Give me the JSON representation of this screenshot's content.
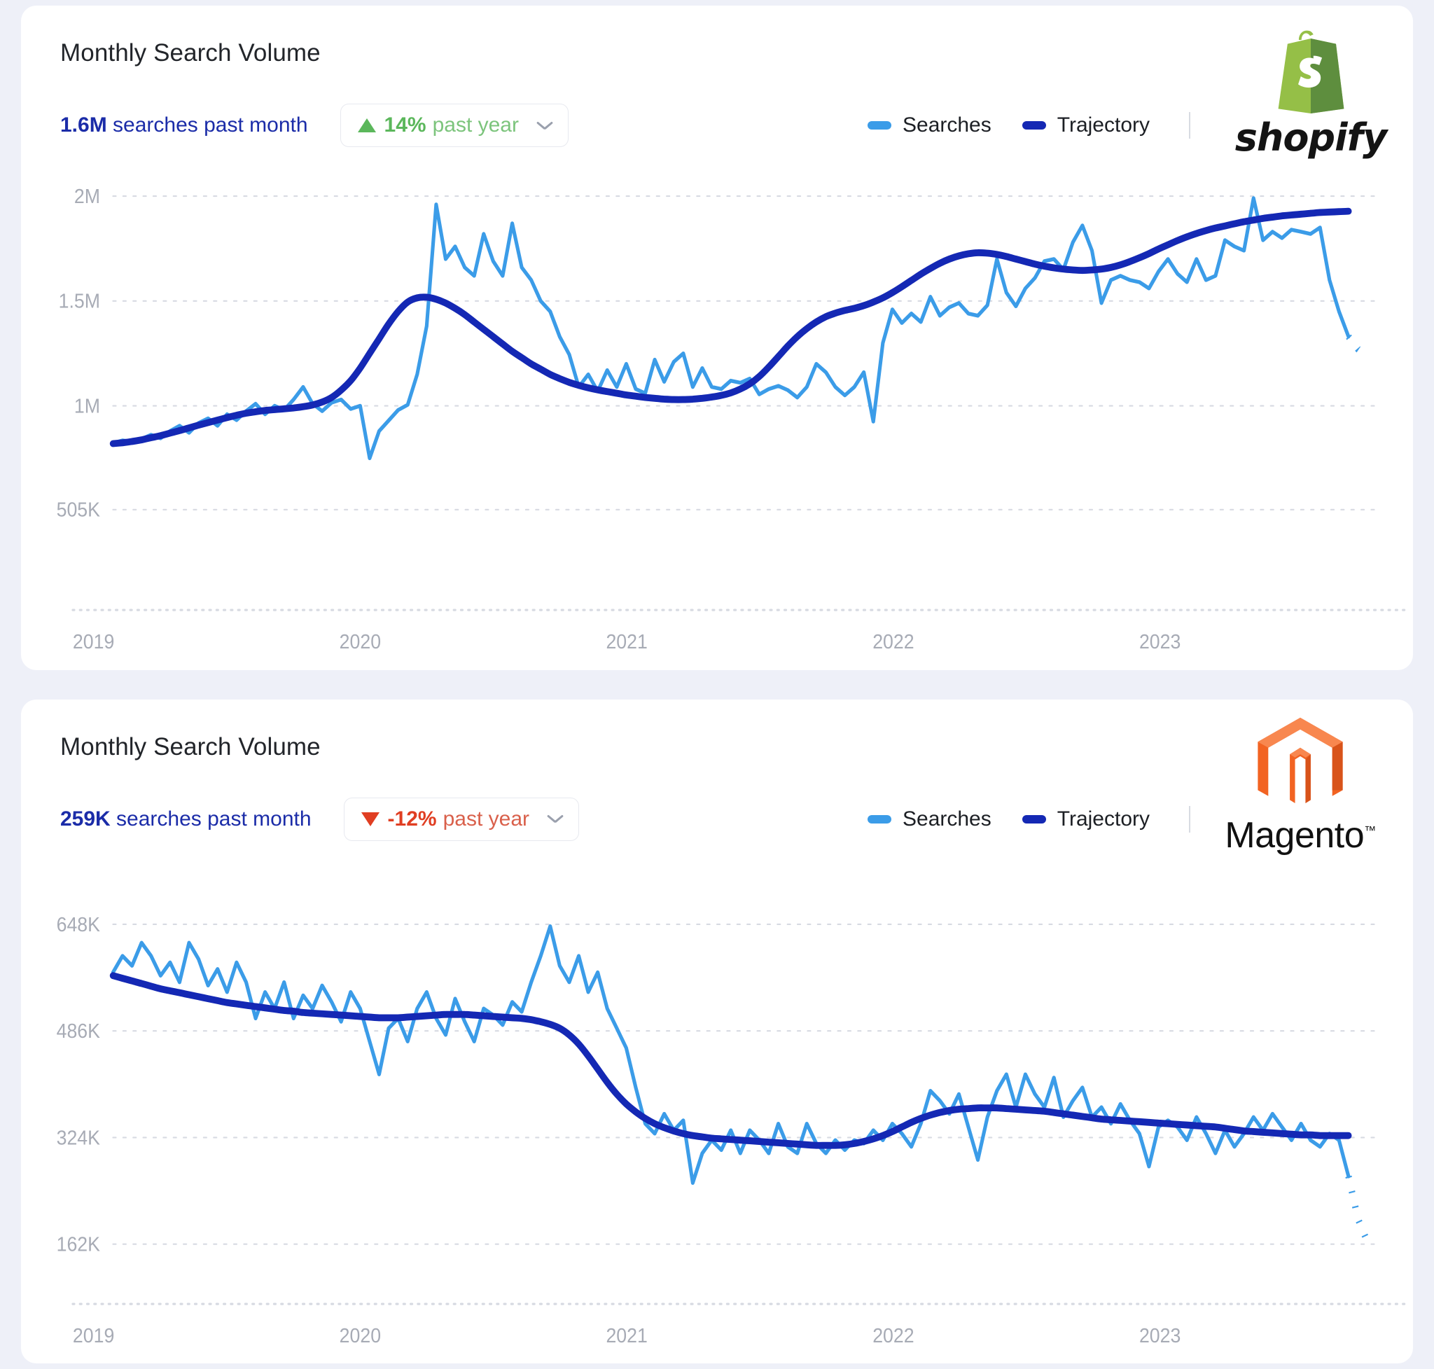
{
  "page": {
    "background": "#eef0f8",
    "accent_searches": "#3b9ce8",
    "accent_trajectory": "#1428b4",
    "stat_color": "#1b2ca8",
    "positive_color": "#5bb75b",
    "negative_color": "#e03e22"
  },
  "cards": [
    {
      "title": "Monthly Search Volume",
      "stat_value": "1.6M",
      "stat_suffix": " searches past month",
      "badge": {
        "direction": "up",
        "percent": "14%",
        "suffix": "past year",
        "chevron": "chevron-down-icon"
      },
      "legend": [
        {
          "label": "Searches",
          "color": "#3b9ce8"
        },
        {
          "label": "Trajectory",
          "color": "#1428b4"
        }
      ],
      "logo": {
        "name": "shopify-logo",
        "wordmark": "shopify",
        "brand_color": "#7ab51d"
      },
      "chart_data": {
        "type": "line",
        "title": "Monthly Search Volume",
        "xlabel": "",
        "ylabel": "",
        "grid": true,
        "legend_position": "top-right",
        "ylim": [
          180000,
          2000000
        ],
        "yticks": [
          2000000,
          1500000,
          1000000,
          505000
        ],
        "ytick_labels": [
          "2M",
          "1.5M",
          "1M",
          "505K"
        ],
        "x": [
          "2019",
          "2020",
          "2021",
          "2022",
          "2023"
        ],
        "xtick_labels": [
          "2019",
          "2020",
          "2021",
          "2022",
          "2023"
        ],
        "series": [
          {
            "name": "Searches",
            "color": "#3b9ce8",
            "values": [
              823000,
              835000,
              828000,
              842000,
              862000,
              845000,
              880000,
              905000,
              872000,
              918000,
              940000,
              905000,
              960000,
              932000,
              975000,
              1010000,
              960000,
              1000000,
              980000,
              1030000,
              1090000,
              1010000,
              975000,
              1015000,
              1030000,
              985000,
              1000000,
              750000,
              880000,
              930000,
              980000,
              1005000,
              1150000,
              1380000,
              1960000,
              1700000,
              1760000,
              1660000,
              1620000,
              1820000,
              1690000,
              1620000,
              1870000,
              1660000,
              1600000,
              1500000,
              1450000,
              1330000,
              1245000,
              1090000,
              1150000,
              1070000,
              1170000,
              1090000,
              1200000,
              1080000,
              1060000,
              1220000,
              1115000,
              1210000,
              1250000,
              1090000,
              1180000,
              1090000,
              1080000,
              1120000,
              1110000,
              1130000,
              1055000,
              1080000,
              1095000,
              1075000,
              1040000,
              1090000,
              1200000,
              1160000,
              1090000,
              1050000,
              1090000,
              1160000,
              925000,
              1300000,
              1460000,
              1395000,
              1440000,
              1400000,
              1520000,
              1430000,
              1470000,
              1490000,
              1440000,
              1430000,
              1480000,
              1700000,
              1540000,
              1475000,
              1560000,
              1610000,
              1690000,
              1700000,
              1650000,
              1780000,
              1860000,
              1740000,
              1490000,
              1600000,
              1620000,
              1600000,
              1590000,
              1560000,
              1640000,
              1700000,
              1630000,
              1590000,
              1700000,
              1600000,
              1620000,
              1790000,
              1760000,
              1740000,
              1990000,
              1790000,
              1830000,
              1800000,
              1840000,
              1830000,
              1820000,
              1850000,
              1600000,
              1450000,
              1330000
            ]
          },
          {
            "name": "Trajectory",
            "color": "#1428b4",
            "values": [
              820000,
              824000,
              830000,
              838000,
              848000,
              858000,
              870000,
              882000,
              895000,
              908000,
              920000,
              932000,
              944000,
              955000,
              965000,
              972000,
              978000,
              982000,
              986000,
              990000,
              996000,
              1004000,
              1018000,
              1040000,
              1075000,
              1120000,
              1180000,
              1250000,
              1320000,
              1390000,
              1450000,
              1495000,
              1515000,
              1518000,
              1508000,
              1490000,
              1465000,
              1435000,
              1400000,
              1365000,
              1330000,
              1295000,
              1260000,
              1230000,
              1200000,
              1175000,
              1150000,
              1130000,
              1112000,
              1098000,
              1086000,
              1076000,
              1068000,
              1060000,
              1052000,
              1046000,
              1040000,
              1036000,
              1032000,
              1030000,
              1030000,
              1032000,
              1036000,
              1042000,
              1050000,
              1062000,
              1080000,
              1105000,
              1140000,
              1185000,
              1235000,
              1285000,
              1330000,
              1368000,
              1400000,
              1425000,
              1442000,
              1455000,
              1465000,
              1478000,
              1495000,
              1515000,
              1540000,
              1568000,
              1598000,
              1628000,
              1655000,
              1680000,
              1700000,
              1715000,
              1725000,
              1730000,
              1728000,
              1722000,
              1712000,
              1700000,
              1688000,
              1676000,
              1666000,
              1658000,
              1652000,
              1648000,
              1646000,
              1648000,
              1652000,
              1660000,
              1672000,
              1688000,
              1706000,
              1726000,
              1748000,
              1768000,
              1788000,
              1806000,
              1822000,
              1836000,
              1848000,
              1858000,
              1868000,
              1878000,
              1886000,
              1894000,
              1900000,
              1906000,
              1910000,
              1914000,
              1918000,
              1922000,
              1924000,
              1926000,
              1928000
            ]
          }
        ],
        "dashed_tail": {
          "series": "Searches",
          "values": [
            1330000,
            1270000,
            1235000
          ]
        }
      }
    },
    {
      "title": "Monthly Search Volume",
      "stat_value": "259K",
      "stat_suffix": " searches past month",
      "badge": {
        "direction": "down",
        "percent": "-12%",
        "suffix": "past year",
        "chevron": "chevron-down-icon"
      },
      "legend": [
        {
          "label": "Searches",
          "color": "#3b9ce8"
        },
        {
          "label": "Trajectory",
          "color": "#1428b4"
        }
      ],
      "logo": {
        "name": "magento-logo",
        "wordmark": "Magento",
        "trademark": "™",
        "brand_color": "#f26322"
      },
      "chart_data": {
        "type": "line",
        "title": "Monthly Search Volume",
        "xlabel": "",
        "ylabel": "",
        "grid": true,
        "legend_position": "top-right",
        "ylim": [
          120000,
          700000
        ],
        "yticks": [
          648000,
          486000,
          324000,
          162000
        ],
        "ytick_labels": [
          "648K",
          "486K",
          "324K",
          "162K"
        ],
        "x": [
          "2019",
          "2020",
          "2021",
          "2022",
          "2023"
        ],
        "xtick_labels": [
          "2019",
          "2020",
          "2021",
          "2022",
          "2023"
        ],
        "series": [
          {
            "name": "Searches",
            "color": "#3b9ce8",
            "values": [
              575000,
              600000,
              585000,
              620000,
              600000,
              570000,
              590000,
              560000,
              620000,
              595000,
              555000,
              580000,
              545000,
              590000,
              560000,
              505000,
              545000,
              520000,
              560000,
              505000,
              540000,
              520000,
              555000,
              530000,
              500000,
              545000,
              520000,
              470000,
              420000,
              490000,
              505000,
              470000,
              520000,
              545000,
              505000,
              480000,
              535000,
              500000,
              470000,
              520000,
              510000,
              495000,
              530000,
              515000,
              560000,
              600000,
              645000,
              585000,
              560000,
              600000,
              545000,
              575000,
              520000,
              490000,
              460000,
              400000,
              345000,
              330000,
              360000,
              335000,
              350000,
              255000,
              300000,
              320000,
              305000,
              335000,
              300000,
              335000,
              320000,
              300000,
              345000,
              310000,
              300000,
              345000,
              315000,
              300000,
              320000,
              305000,
              320000,
              315000,
              335000,
              320000,
              345000,
              330000,
              310000,
              345000,
              395000,
              380000,
              360000,
              390000,
              340000,
              290000,
              355000,
              395000,
              420000,
              370000,
              420000,
              390000,
              370000,
              415000,
              355000,
              380000,
              400000,
              355000,
              370000,
              345000,
              375000,
              350000,
              330000,
              280000,
              340000,
              350000,
              340000,
              320000,
              355000,
              330000,
              300000,
              335000,
              310000,
              330000,
              355000,
              335000,
              360000,
              340000,
              320000,
              345000,
              320000,
              310000,
              330000,
              320000,
              265000
            ]
          },
          {
            "name": "Trajectory",
            "color": "#1428b4",
            "values": [
              570000,
              566000,
              562000,
              558000,
              554000,
              550000,
              547000,
              544000,
              541000,
              538000,
              535000,
              532000,
              529000,
              527000,
              525000,
              523000,
              521000,
              519000,
              517000,
              516000,
              514000,
              513000,
              512000,
              511000,
              510000,
              509000,
              508000,
              507000,
              506000,
              506000,
              506000,
              507000,
              508000,
              509000,
              510000,
              511000,
              511000,
              511000,
              510000,
              509000,
              508000,
              507000,
              506000,
              505000,
              503000,
              500000,
              496000,
              490000,
              480000,
              466000,
              448000,
              428000,
              408000,
              390000,
              375000,
              363000,
              353000,
              345000,
              339000,
              334000,
              330000,
              327000,
              325000,
              323000,
              322000,
              321000,
              320000,
              319000,
              318000,
              317000,
              316000,
              315000,
              314000,
              313000,
              312000,
              312000,
              312000,
              313000,
              315000,
              318000,
              322000,
              327000,
              333000,
              340000,
              347000,
              353000,
              358000,
              362000,
              365000,
              367000,
              368000,
              369000,
              369000,
              369000,
              368000,
              367000,
              366000,
              365000,
              364000,
              362000,
              360000,
              358000,
              356000,
              354000,
              352000,
              351000,
              350000,
              349000,
              348000,
              347000,
              346000,
              345000,
              344000,
              343000,
              342000,
              341000,
              340000,
              338000,
              336000,
              334000,
              333000,
              332000,
              331000,
              330000,
              329000,
              328000,
              328000,
              327000,
              327000,
              327000,
              327000
            ]
          }
        ],
        "dashed_tail": {
          "series": "Searches",
          "values": [
            265000,
            200000,
            165000
          ]
        }
      }
    }
  ]
}
